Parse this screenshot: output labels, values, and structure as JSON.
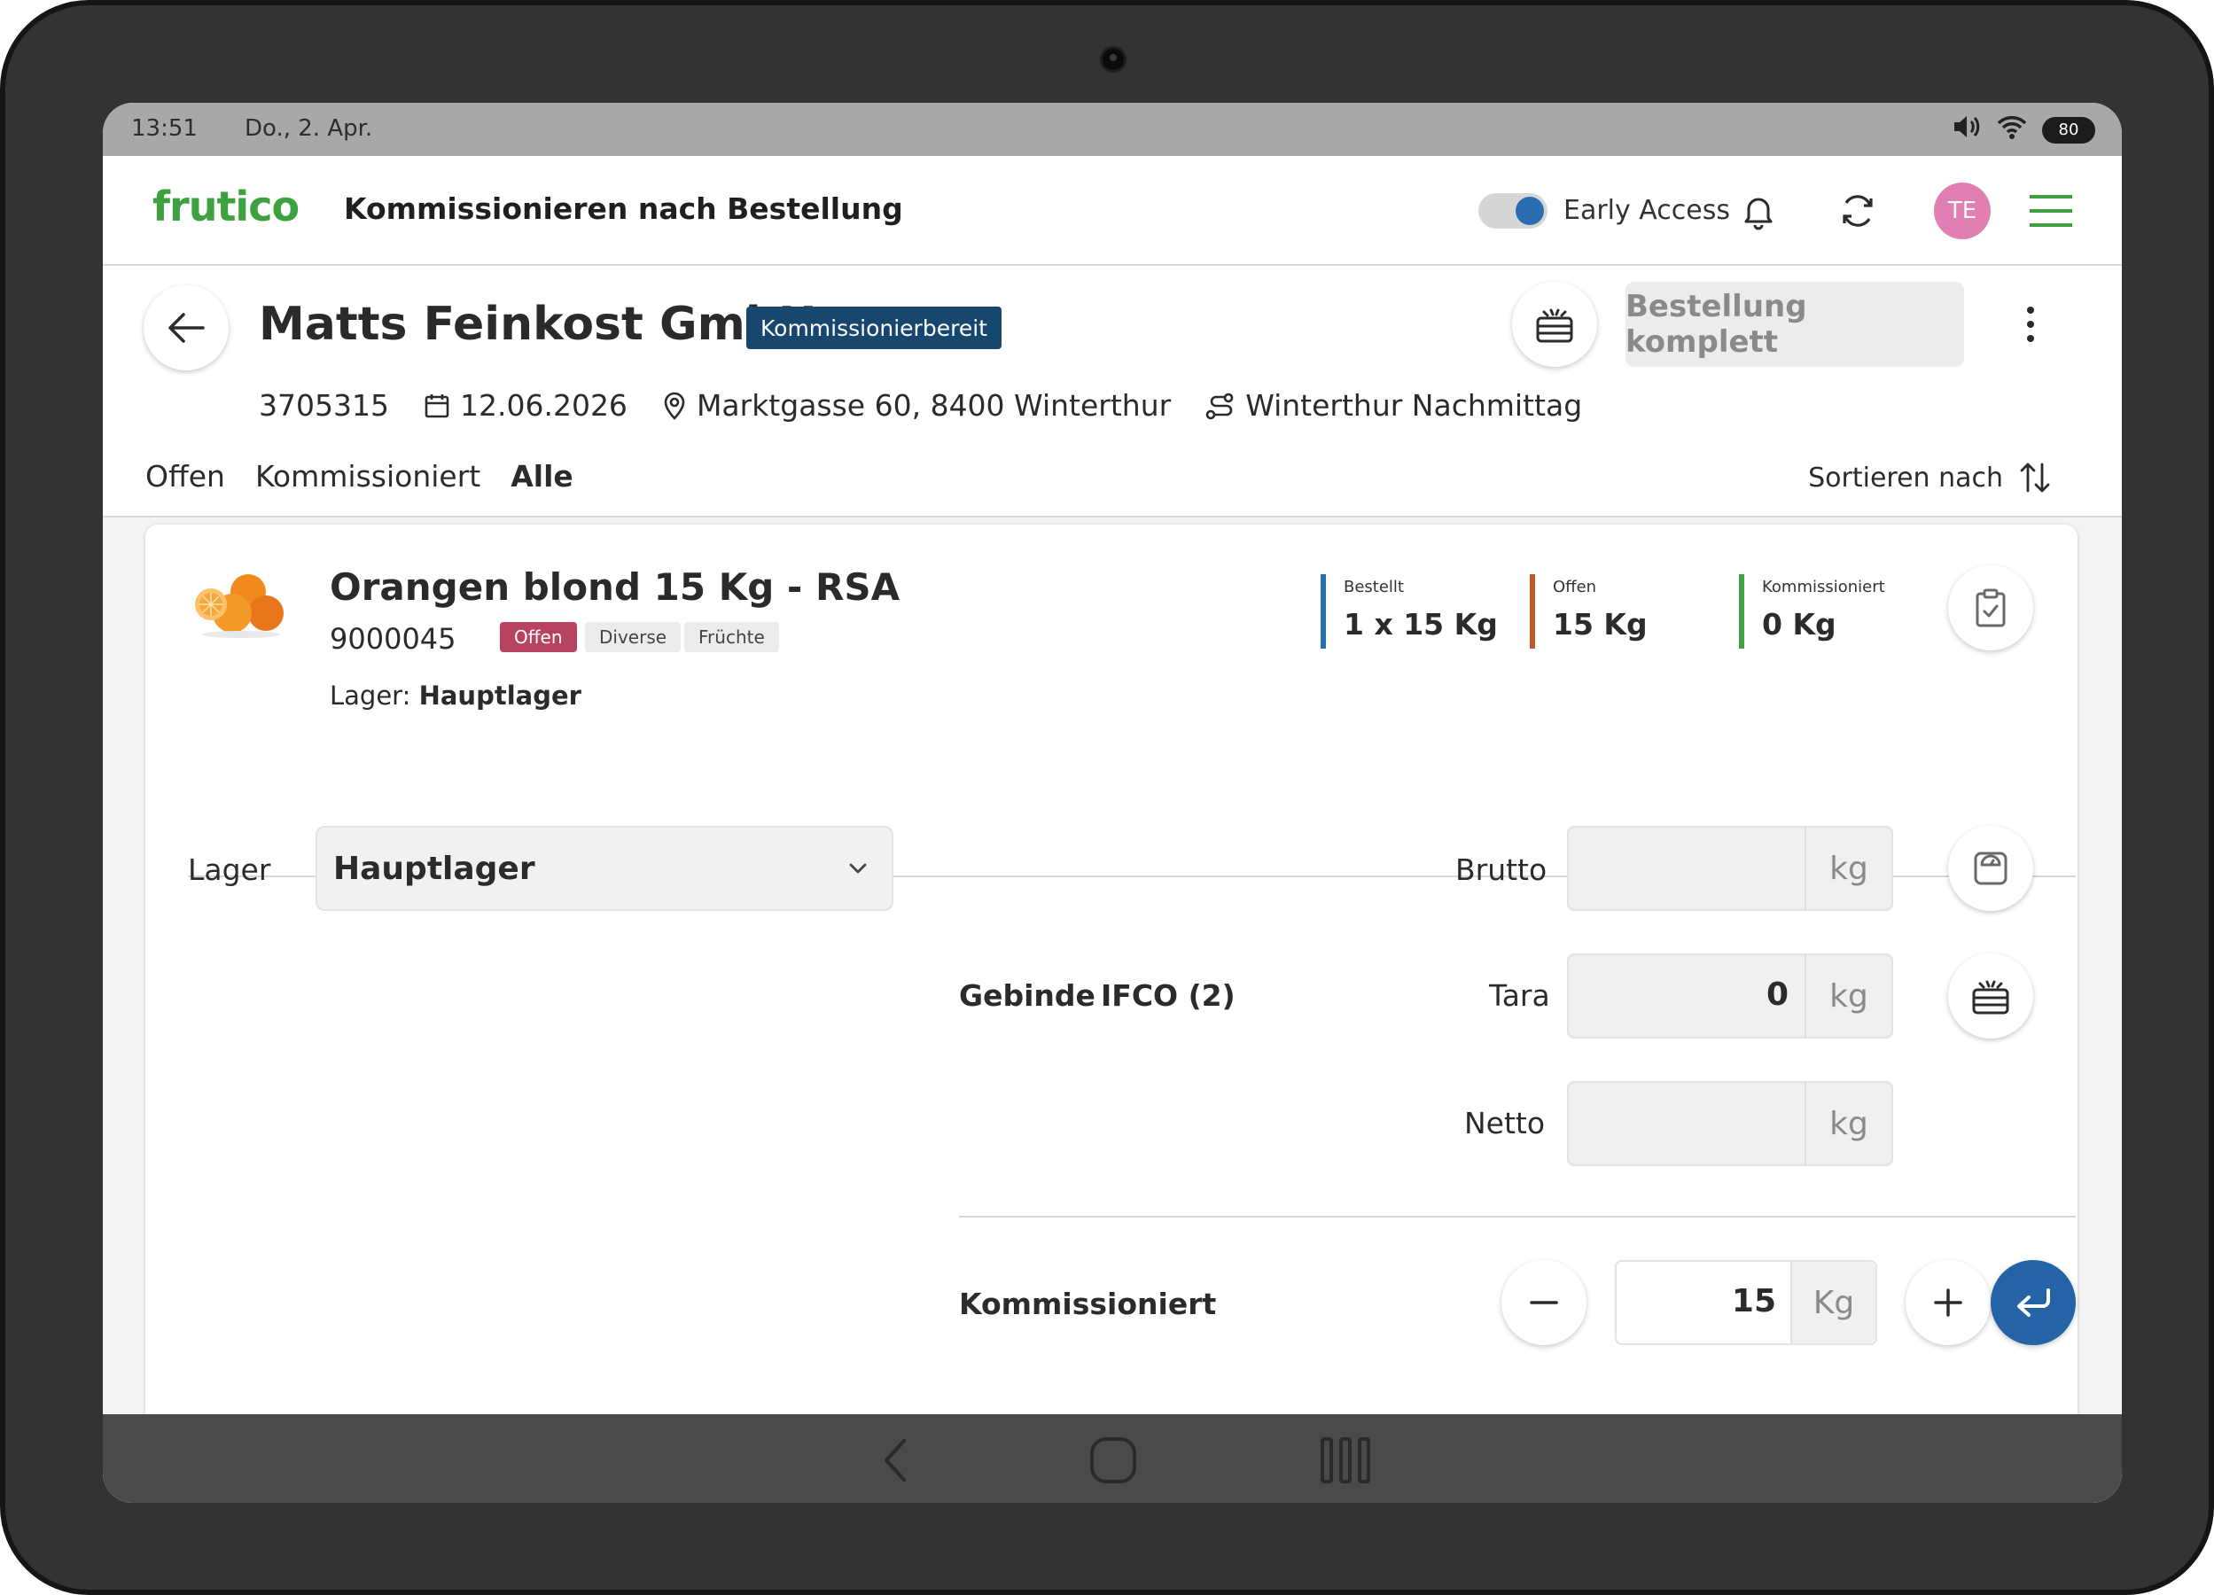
{
  "status_bar": {
    "time": "13:51",
    "date": "Do., 2. Apr.",
    "battery": "80"
  },
  "app_header": {
    "logo": "frutico",
    "title": "Kommissionieren nach Bestellung",
    "early_access_label": "Early Access",
    "early_access_on": true,
    "avatar_initials": "TE"
  },
  "order": {
    "customer": "Matts Feinkost GmbH",
    "status_badge": "Kommissionierbereit",
    "complete_button": "Bestellung komplett",
    "number": "3705315",
    "date": "12.06.2026",
    "address": "Marktgasse 60, 8400 Winterthur",
    "route": "Winterthur Nachmittag"
  },
  "tabs": [
    "Offen",
    "Kommissioniert",
    "Alle"
  ],
  "active_tab": "Alle",
  "sort_label": "Sortieren nach",
  "item": {
    "name": "Orangen blond 15 Kg - RSA",
    "article_number": "9000045",
    "tags": {
      "status": "Offen",
      "category": "Diverse",
      "group": "Früchte"
    },
    "warehouse_prefix": "Lager:",
    "warehouse": "Hauptlager",
    "stats": {
      "ordered_label": "Bestellt",
      "ordered_value": "1 x 15 Kg",
      "open_label": "Offen",
      "open_value": "15 Kg",
      "picked_label": "Kommissioniert",
      "picked_value": "0 Kg"
    }
  },
  "form": {
    "lager_label": "Lager",
    "lager_selected": "Hauptlager",
    "gebinde_label": "Gebinde",
    "gebinde_value": "IFCO (2)",
    "brutto_label": "Brutto",
    "brutto_value": "",
    "brutto_unit": "kg",
    "tara_label": "Tara",
    "tara_value": "0",
    "tara_unit": "kg",
    "netto_label": "Netto",
    "netto_value": "",
    "netto_unit": "kg",
    "picked_label": "Kommissioniert",
    "picked_value": "15",
    "picked_unit": "Kg"
  },
  "colors": {
    "brand_green": "#3ea13f",
    "primary_blue": "#2464a6",
    "status_badge": "#17466f",
    "open_tag": "#b8425f",
    "avatar": "#e17fb3"
  }
}
